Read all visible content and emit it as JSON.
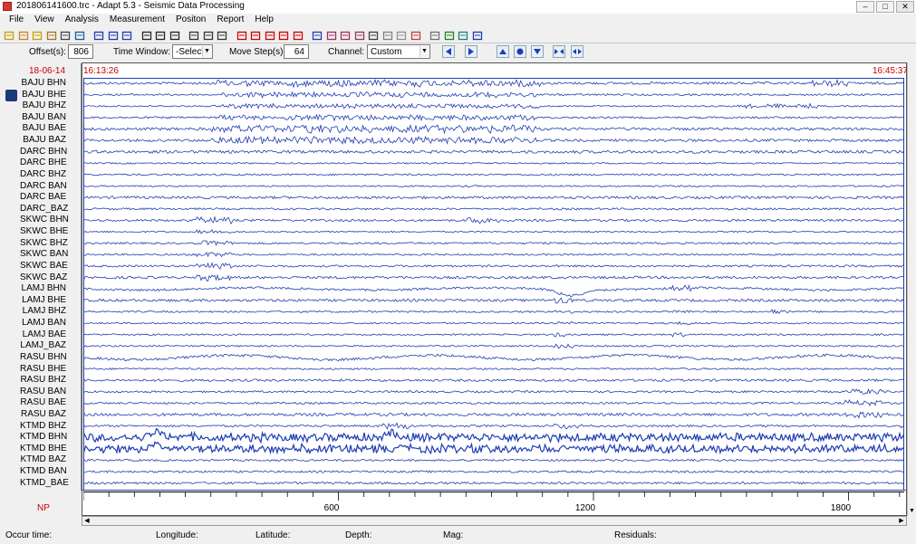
{
  "window": {
    "title": "201806141600.trc - Adapt 5.3 - Seismic Data Processing",
    "minimize": "–",
    "maximize": "□",
    "close": "✕"
  },
  "menu": [
    "File",
    "View",
    "Analysis",
    "Measurement",
    "Positon",
    "Report",
    "Help"
  ],
  "toolbar_icons": [
    "new-file-icon",
    "open-file-icon",
    "open-folder-icon",
    "open-multiple-icon",
    "print-icon",
    "export-icon",
    "step-back-icon",
    "play-icon",
    "stop-icon",
    "save-icon",
    "save-as-icon",
    "save-disk-icon",
    "list-icon",
    "columns-icon",
    "checklist-icon",
    "pick-icon",
    "pick-multi-icon",
    "pick-p-icon",
    "pick-s-icon",
    "curve-icon",
    "zoom-icon",
    "spectrum-icon",
    "ruler-icon",
    "filter-icon",
    "wave-icon",
    "magic-icon",
    "star-icon",
    "sun-icon",
    "edit-icon",
    "grid-icon",
    "map-icon",
    "table-icon"
  ],
  "controls": {
    "offset_label": "Offset(s):",
    "offset_value": "806",
    "time_window_label": "Time Window:",
    "time_window_value": "-Select-",
    "move_step_label": "Move Step(s):",
    "move_step_value": "64",
    "channel_label": "Channel:",
    "channel_value": "Custom"
  },
  "plot": {
    "date": "18-06-14",
    "start_time": "16:13:26",
    "end_time": "16:45:37",
    "np_label": "NP",
    "trace_color": "#1e3cb4",
    "time_marker_color": "#cc0000",
    "channels": [
      "BAJU  BHN",
      "BAJU  BHE",
      "BAJU  BHZ",
      "BAJU  BAN",
      "BAJU  BAE",
      "BAJU  BAZ",
      "DARC  BHN",
      "DARC  BHE",
      "DARC  BHZ",
      "DARC  BAN",
      "DARC  BAE",
      "DARC_BAZ",
      "SKWC  BHN",
      "SKWC  BHE",
      "SKWC  BHZ",
      "SKWC  BAN",
      "SKWC  BAE",
      "SKWC  BAZ",
      "LAMJ  BHN",
      "LAMJ  BHE",
      "LAMJ  BHZ",
      "LAMJ  BAN",
      "LAMJ  BAE",
      "LAMJ_BAZ",
      "RASU  BHN",
      "RASU  BHE",
      "RASU  BHZ",
      "RASU  BAN",
      "RASU  BAE",
      "RASU  BAZ",
      "KTMD  BHZ",
      "KTMD  BHN",
      "KTMD  BHE",
      "KTMD  BAZ",
      "KTMD  BAN",
      "KTMD_BAE"
    ],
    "axis_labels": [
      "600",
      "1200",
      "1800"
    ]
  },
  "status": {
    "occur_time": "Occur time:",
    "longitude": "Longitude:",
    "latitude": "Latitude:",
    "depth": "Depth:",
    "mag": "Mag:",
    "residuals": "Residuals:"
  }
}
